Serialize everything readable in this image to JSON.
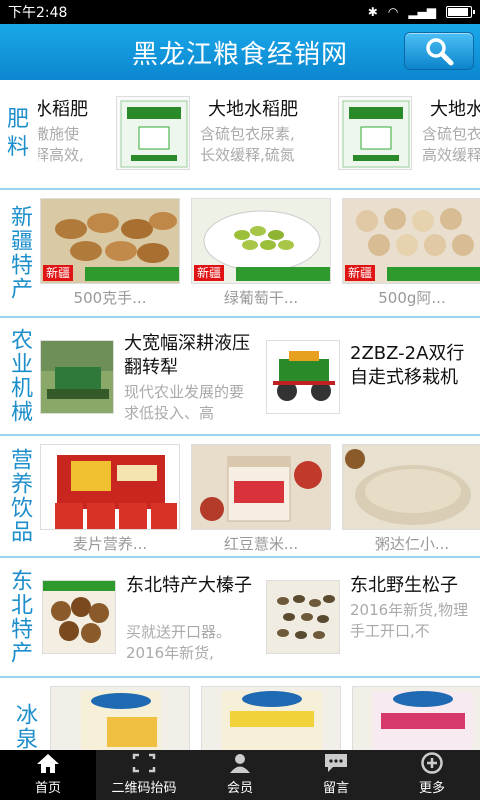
{
  "status": {
    "time": "下午2:48"
  },
  "header": {
    "title": "黑龙江粮食经销网",
    "search_icon": "search-icon"
  },
  "sections": {
    "fertilizer": {
      "label": "肥料",
      "items": [
        {
          "title": "水稻肥",
          "desc1": "撒施使",
          "desc2": "释高效,"
        },
        {
          "title": "大地水稻肥",
          "desc1": "含硫包衣尿素,",
          "desc2": "长效缓释,硫氮"
        },
        {
          "title": "大地水",
          "desc1": "含硫包衣",
          "desc2": "高效缓释"
        }
      ]
    },
    "xinjiang": {
      "label": "新疆特产",
      "items": [
        {
          "name": "500克手...",
          "tag": "新疆"
        },
        {
          "name": "绿葡萄干...",
          "tag": "新疆"
        },
        {
          "name": "500g阿...",
          "tag": "新疆"
        }
      ]
    },
    "machinery": {
      "label": "农业机械",
      "items": [
        {
          "title": "大宽幅深耕液压翻转犁",
          "desc": "现代农业发展的要求低投入、高"
        },
        {
          "title": "2ZBZ-2A双行自走式移栽机",
          "desc": ""
        }
      ]
    },
    "drinks": {
      "label": "营养饮品",
      "items": [
        {
          "name": "麦片营养..."
        },
        {
          "name": "红豆薏米..."
        },
        {
          "name": "粥达仁小..."
        }
      ]
    },
    "northeast": {
      "label": "东北特产",
      "items": [
        {
          "title": "东北特产大榛子",
          "desc": "买就送开口器。2016年新货,"
        },
        {
          "title": "东北野生松子",
          "desc": "2016年新货,物理手工开口,不"
        }
      ]
    },
    "icespring": {
      "label": "冰泉",
      "items": [
        {
          "name": ""
        },
        {
          "name": ""
        },
        {
          "name": ""
        }
      ]
    }
  },
  "bottom_nav": [
    {
      "label": "首页",
      "icon": "home-icon",
      "active": true
    },
    {
      "label": "二维码抬码",
      "icon": "qr-scan-icon",
      "active": false
    },
    {
      "label": "会员",
      "icon": "member-icon",
      "active": false
    },
    {
      "label": "留言",
      "icon": "message-icon",
      "active": false
    },
    {
      "label": "更多",
      "icon": "more-icon",
      "active": false
    }
  ],
  "colors": {
    "header": "#0b86cf",
    "section_label": "#1c8ecb",
    "tag": "#e01414"
  }
}
